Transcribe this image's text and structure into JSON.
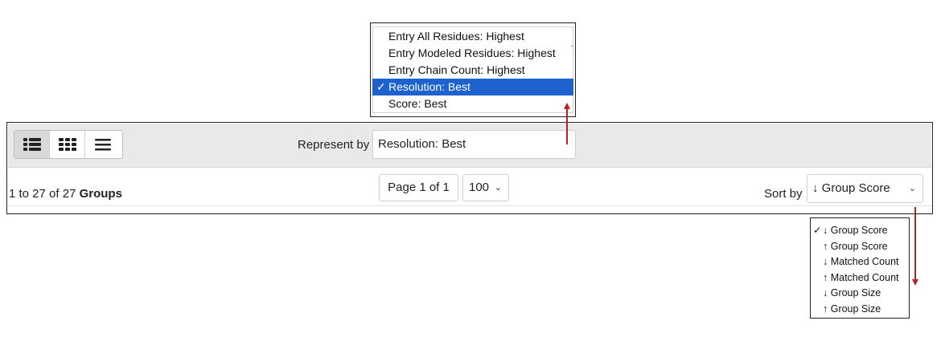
{
  "represent_dropdown": {
    "options": [
      {
        "label": "Entry All Residues: Highest",
        "selected": false
      },
      {
        "label": "Entry Modeled Residues: Highest",
        "selected": false
      },
      {
        "label": "Entry Chain Count: Highest",
        "selected": false
      },
      {
        "label": "Resolution: Best",
        "selected": true
      },
      {
        "label": "Score: Best",
        "selected": false
      }
    ],
    "check_mark": "✓"
  },
  "toolbar": {
    "view_buttons": [
      {
        "name": "detailed-list-view-icon",
        "active": true
      },
      {
        "name": "grid-view-icon",
        "active": false
      },
      {
        "name": "compact-list-view-icon",
        "active": false
      }
    ],
    "represent_label": "Represent by",
    "represent_value": "Resolution: Best"
  },
  "results": {
    "prefix": "1 to 27 of 27 ",
    "unit": "Groups"
  },
  "pagination": {
    "page_text": "Page 1 of 1",
    "per_page": "100"
  },
  "sort": {
    "label": "Sort by",
    "value": "↓ Group Score",
    "options": [
      {
        "label": "↓ Group Score",
        "selected": true
      },
      {
        "label": "↑ Group Score",
        "selected": false
      },
      {
        "label": "↓ Matched Count",
        "selected": false
      },
      {
        "label": "↑ Matched Count",
        "selected": false
      },
      {
        "label": "↓ Group Size",
        "selected": false
      },
      {
        "label": "↑ Group Size",
        "selected": false
      }
    ],
    "check_mark": "✓"
  },
  "colors": {
    "selection": "#1e62d0",
    "annotation_arrow": "#b3261e",
    "toolbar_bg": "#e9e9e9"
  }
}
